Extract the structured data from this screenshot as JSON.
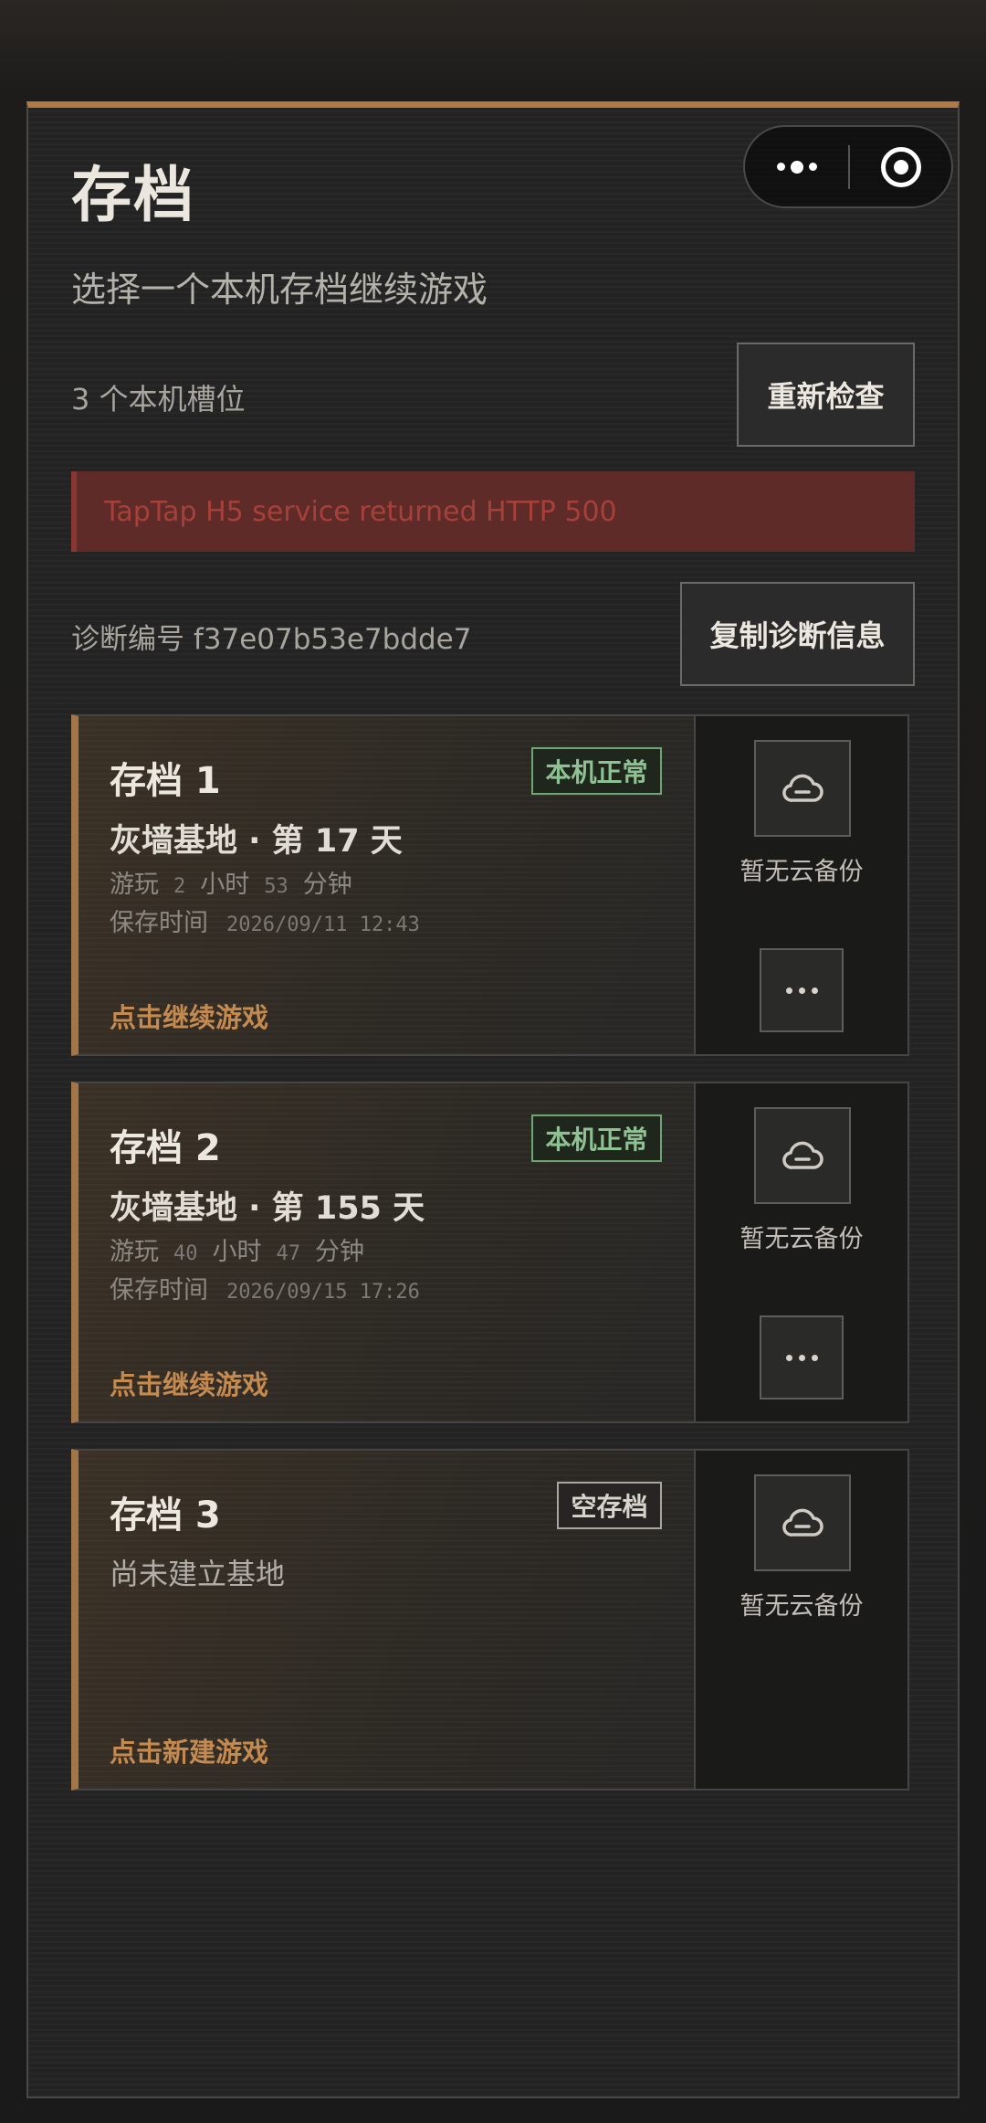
{
  "header": {
    "title": "存档",
    "subtitle": "选择一个本机存档继续游戏"
  },
  "toolbar": {
    "slot_count_text": "3 个本机槽位",
    "recheck_label": "重新检查"
  },
  "error": {
    "message": "TapTap H5 service returned HTTP 500"
  },
  "diagnostics": {
    "id_text": "诊断编号 f37e07b53e7bdde7",
    "copy_label": "复制诊断信息"
  },
  "slots": [
    {
      "name": "存档 1",
      "badge": "本机正常",
      "base": "灰墙基地 · 第 17 天",
      "play_prefix": "游玩",
      "hours": "2",
      "hours_unit": "小时",
      "minutes": "53",
      "minutes_unit": "分钟",
      "saved_label": "保存时间",
      "saved_time": "2026/09/11 12:43",
      "action": "点击继续游戏",
      "cloud_label": "暂无云备份"
    },
    {
      "name": "存档 2",
      "badge": "本机正常",
      "base": "灰墙基地 · 第 155 天",
      "play_prefix": "游玩",
      "hours": "40",
      "hours_unit": "小时",
      "minutes": "47",
      "minutes_unit": "分钟",
      "saved_label": "保存时间",
      "saved_time": "2026/09/15 17:26",
      "action": "点击继续游戏",
      "cloud_label": "暂无云备份"
    },
    {
      "name": "存档 3",
      "badge": "空存档",
      "empty_text": "尚未建立基地",
      "action": "点击新建游戏",
      "cloud_label": "暂无云备份"
    }
  ],
  "colors": {
    "accent": "#b07a45",
    "action_text": "#c48a4f",
    "ok_badge": "#8fc293",
    "error_bg": "#5e2b28",
    "error_text": "#a8403a"
  },
  "icons": {
    "capsule_more": "more-dots-icon",
    "capsule_close": "target-circle-icon",
    "cloud": "cloud-minus-icon",
    "slot_menu": "ellipsis-icon"
  }
}
